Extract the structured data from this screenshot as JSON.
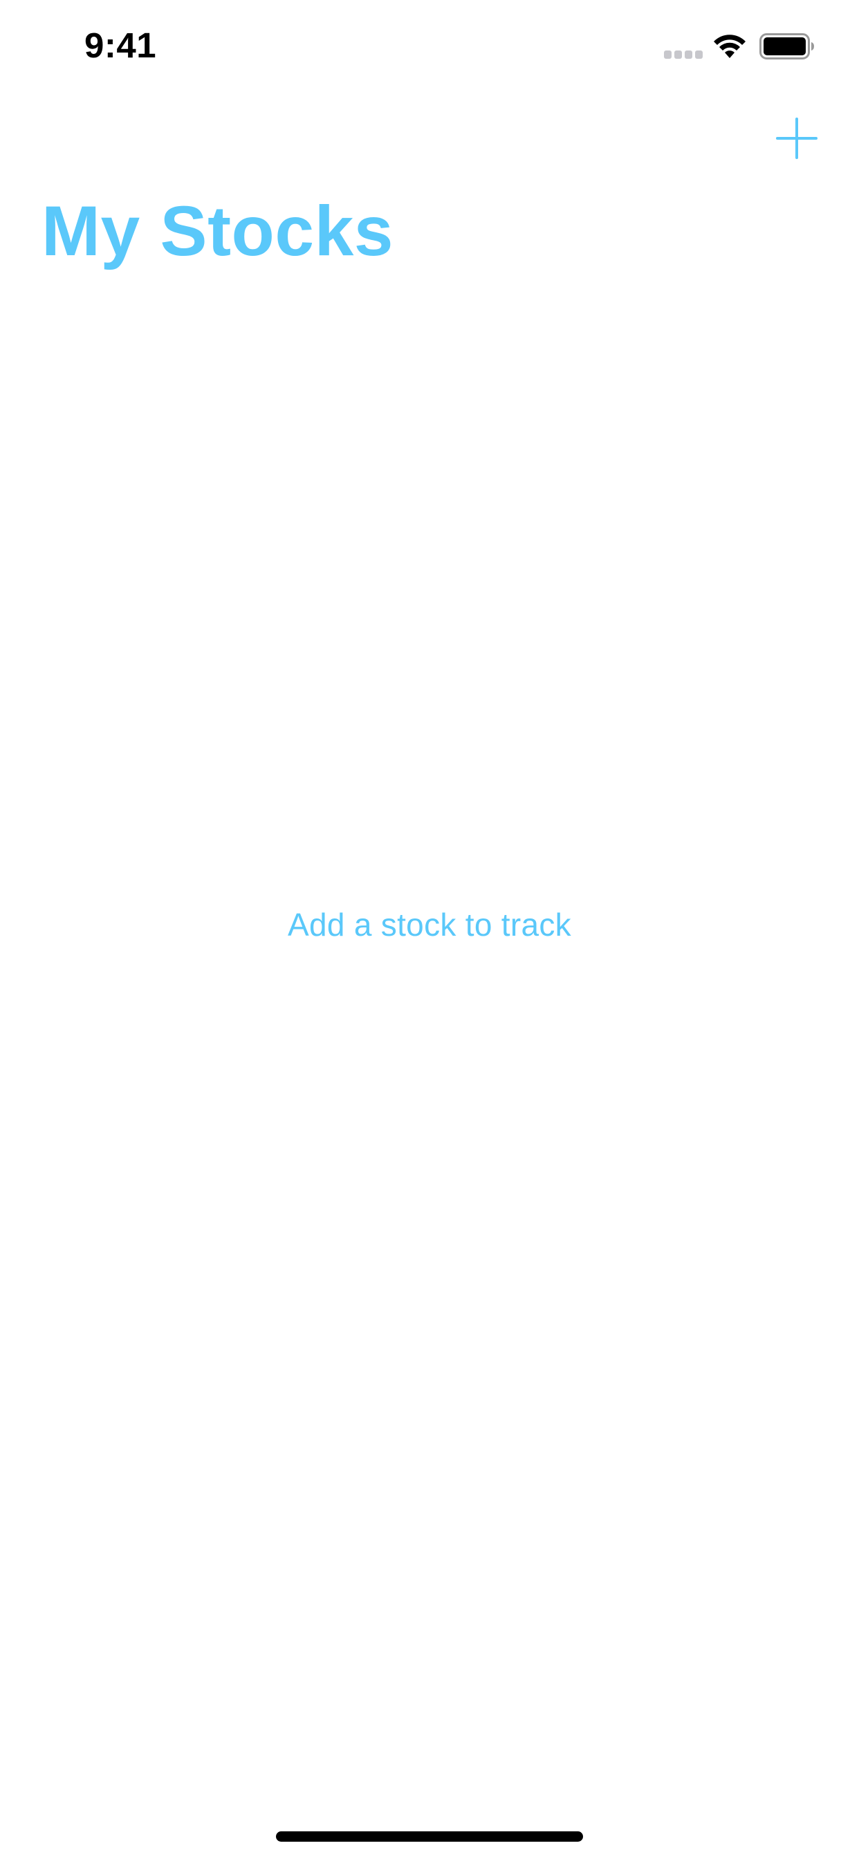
{
  "status_bar": {
    "time": "9:41"
  },
  "nav": {
    "add_icon": "plus-icon",
    "title": "My Stocks"
  },
  "empty_state": {
    "message": "Add a stock to track"
  },
  "colors": {
    "accent": "#5ac8fa",
    "background": "#ffffff",
    "status_text": "#000000"
  },
  "icons": {
    "signal": "cellular-signal-icon",
    "wifi": "wifi-icon",
    "battery": "battery-icon"
  }
}
